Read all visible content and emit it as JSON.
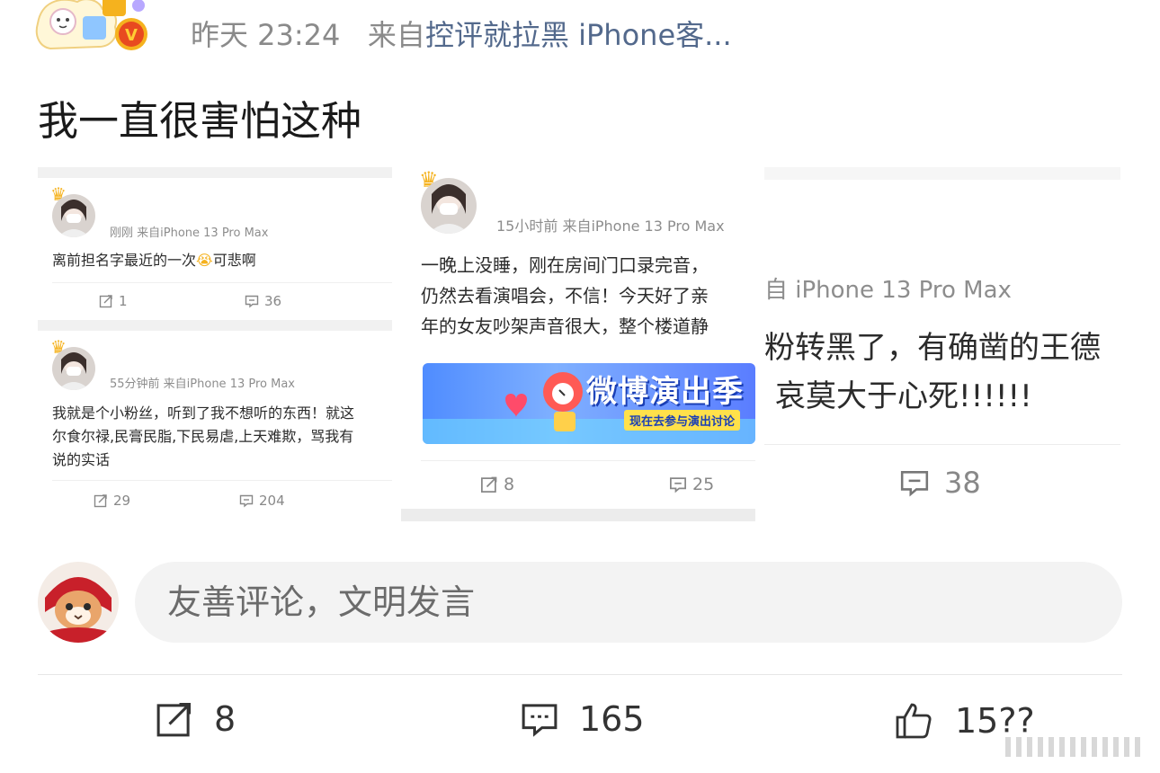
{
  "header": {
    "time": "昨天 23:24",
    "source_prefix": "来自",
    "source_name": "控评就拉黑 iPhone客..."
  },
  "post": {
    "text": "我一直很害怕这种"
  },
  "images": {
    "left": {
      "card1": {
        "meta": "刚刚  来自iPhone 13 Pro Max",
        "text_a": "离前担名字最近的一次",
        "text_b": "可悲啊",
        "reposts": "1",
        "comments": "36"
      },
      "card2": {
        "meta": "55分钟前  来自iPhone 13 Pro Max",
        "lines": [
          "我就是个小粉丝，听到了我不想听的东西！就这",
          "尔食尔禄,民膏民脂,下民易虐,上天难欺，骂我有",
          "说的实话"
        ],
        "reposts": "29",
        "comments": "204"
      }
    },
    "middle": {
      "meta": "15小时前  来自iPhone 13 Pro Max",
      "lines": [
        "一晚上没睡，刚在房间门口录完音，",
        "仍然去看演唱会，不信！今天好了亲",
        "年的女友吵架声音很大，整个楼道静"
      ],
      "banner_title": "微博演出季",
      "banner_sub": "现在去参与演出讨论",
      "reposts": "8",
      "comments": "25"
    },
    "right": {
      "meta": "自 iPhone 13 Pro Max",
      "lines": [
        "粉转黑了，有确凿的王德",
        "哀莫大于心死!!!!!!"
      ],
      "comments": "38"
    }
  },
  "comment_box": {
    "placeholder": "友善评论，文明发言"
  },
  "actions": {
    "repost_count": "8",
    "comment_count": "165",
    "like_count": "15??"
  },
  "colors": {
    "link": "#53698c",
    "meta": "#8a8a8a",
    "input_bg": "#f3f3f3",
    "crown": "#f5b21e"
  }
}
